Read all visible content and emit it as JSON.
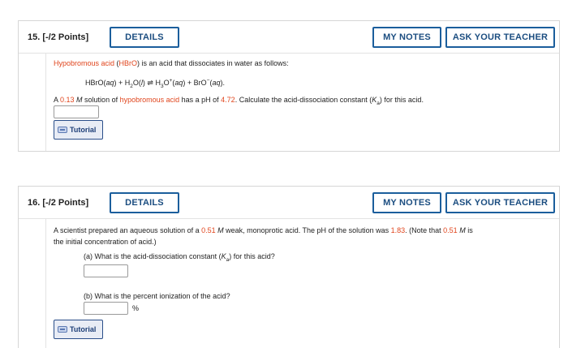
{
  "q15": {
    "number": "15.  [-/2 Points]",
    "details": "DETAILS",
    "my_notes": "MY NOTES",
    "ask_teacher": "ASK YOUR TEACHER",
    "acid_name": "Hypobromous acid",
    "formula_hbro": "HBrO",
    "intro_rest": " is an acid that dissociates in water as follows:",
    "eq_hbro": "HBrO(",
    "eq_aq1": "aq",
    "eq_plus_h2o": ") + H",
    "eq_2": "2",
    "eq_o": "O(",
    "eq_l": "l",
    "eq_close": ")",
    "eq_arrow": "⇌",
    "eq_h3o": " H",
    "eq_3": "3",
    "eq_o2": "O",
    "eq_plus_sup": "+",
    "eq_paren": "(",
    "eq_aq2": "aq",
    "eq_plus_bro": ") + BrO",
    "eq_minus_sup": "−",
    "eq_paren2": "(",
    "eq_aq3": "aq",
    "eq_end": ").",
    "stmt_a": "A ",
    "conc": "0.13",
    "stmt_m": " M",
    "stmt_b": " solution of ",
    "acid_name2": "hypobromous acid",
    "stmt_c": " has a pH of ",
    "ph": "4.72",
    "stmt_d": ". Calculate the acid-dissociation constant (",
    "ka_k": "K",
    "ka_a": "a",
    "stmt_e": ") for this acid.",
    "tutorial": "Tutorial"
  },
  "q16": {
    "number": "16.  [-/2 Points]",
    "details": "DETAILS",
    "my_notes": "MY NOTES",
    "ask_teacher": "ASK YOUR TEACHER",
    "s1": "A scientist prepared an aqueous solution of a ",
    "conc1": "0.51",
    "m1": " M",
    "s2": " weak, monoprotic acid. The pH of the solution was ",
    "ph": "1.83",
    "s3": ". (Note that ",
    "conc2": "0.51",
    "m2": " M",
    "s4": " is",
    "s5": "the initial concentration of acid.)",
    "pa1": "(a) What is the acid-dissociation constant (",
    "ka_k": "K",
    "ka_a": "a",
    "pa2": ") for this acid?",
    "pb": "(b) What is the percent ionization of the acid?",
    "pct": "%",
    "tutorial": "Tutorial"
  }
}
